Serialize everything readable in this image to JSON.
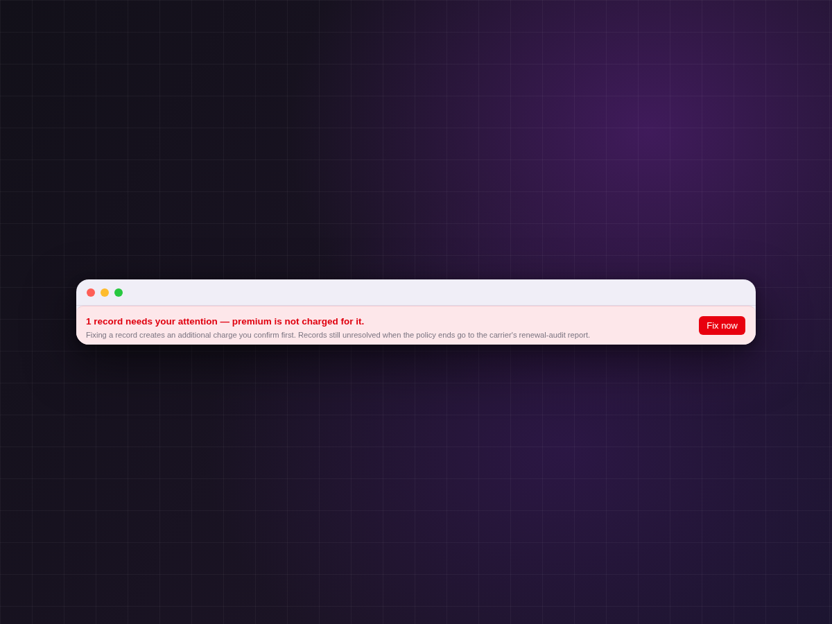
{
  "window": {
    "controls": [
      {
        "kind": "close"
      },
      {
        "kind": "minimize"
      },
      {
        "kind": "maximize"
      }
    ]
  },
  "banner": {
    "title": "1 record needs your attention — premium is not charged for it.",
    "description": "Fixing a record creates an additional charge you confirm first. Records still unresolved when the policy ends go to the carrier's renewal-audit report.",
    "button": "Fix now"
  }
}
